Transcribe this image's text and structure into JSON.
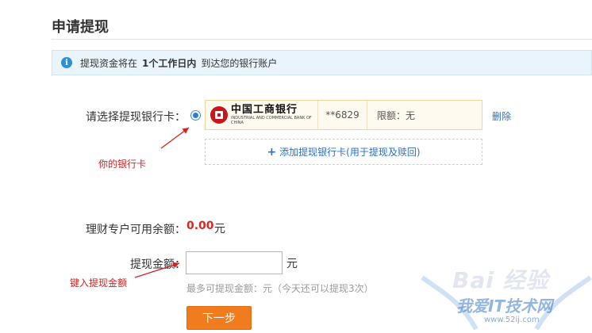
{
  "page": {
    "title": "申请提现"
  },
  "info": {
    "icon": "info-icon",
    "prefix": "提现资金将在",
    "emphasis": "1个工作日内",
    "suffix": "到达您的银行账户"
  },
  "bank_select": {
    "label": "请选择提现银行卡：",
    "card": {
      "bank_name": "中国工商银行",
      "bank_name_en": "INDUSTRIAL AND COMMERCIAL BANK OF CHINA",
      "number": "**6829",
      "limit": "限额：无",
      "selected": true
    },
    "delete_label": "删除",
    "add_card_label": "添加提现银行卡(用于提现及赎回)"
  },
  "balance": {
    "label": "理财专户可用余额：",
    "value": "0.00",
    "unit": "元"
  },
  "amount": {
    "label": "提现金额：",
    "value": "",
    "unit": "元",
    "hint": "最多可提现金额：元（今天还可以提现3次）"
  },
  "next_button": "下一步",
  "annotations": {
    "card_note": "你的银行卡",
    "amount_note": "键入提现金额",
    "color": "#d22222"
  },
  "watermark": {
    "brand": "Bai 经验",
    "site": "我爱IT技术网",
    "url": "www.52ij.com"
  },
  "colors": {
    "accent_orange": "#f07c1e",
    "link_blue": "#2a6fc9",
    "amount_red": "#e0231f",
    "info_bg": "#eaf4fc"
  }
}
